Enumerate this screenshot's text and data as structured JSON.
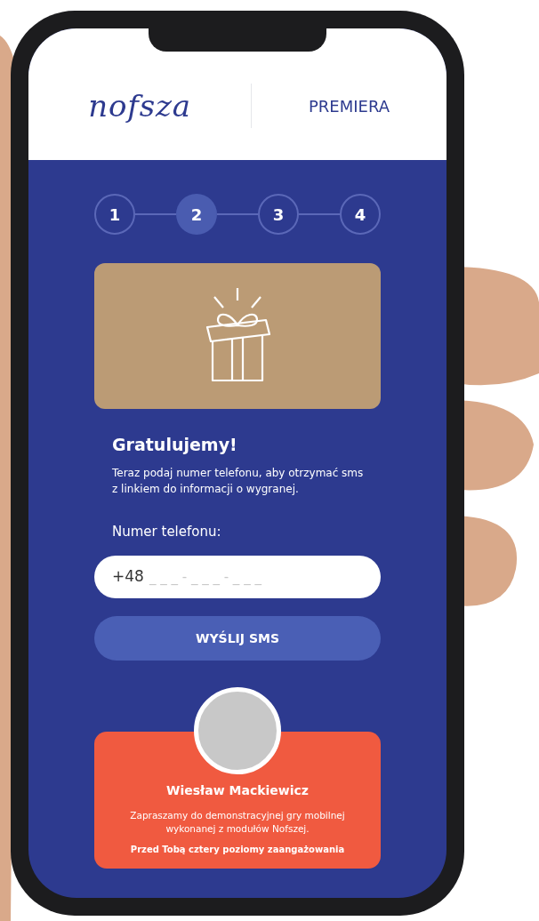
{
  "header": {
    "logo": "nofsza",
    "title": "PREMIERA"
  },
  "steps": [
    {
      "label": "1",
      "selected": false
    },
    {
      "label": "2",
      "selected": true
    },
    {
      "label": "3",
      "selected": false
    },
    {
      "label": "4",
      "selected": false
    }
  ],
  "heading": "Gratulujemy!",
  "intro": "Teraz podaj numer telefonu, aby otrzymać sms z linkiem do informacji o wygranej.",
  "phone_field": {
    "label": "Numer telefonu:",
    "value": "+48",
    "placeholder": "_ _ _ - _ _ _ - _ _ _"
  },
  "submit_button": "WYŚLIJ SMS",
  "host_card": {
    "name": "Wiesław Mackiewicz",
    "text": "Zapraszamy do demonstracyjnej gry mobilnej wykonanej z modułów Nofszej.",
    "note": "Przed Tobą cztery poziomy zaangażowania"
  }
}
